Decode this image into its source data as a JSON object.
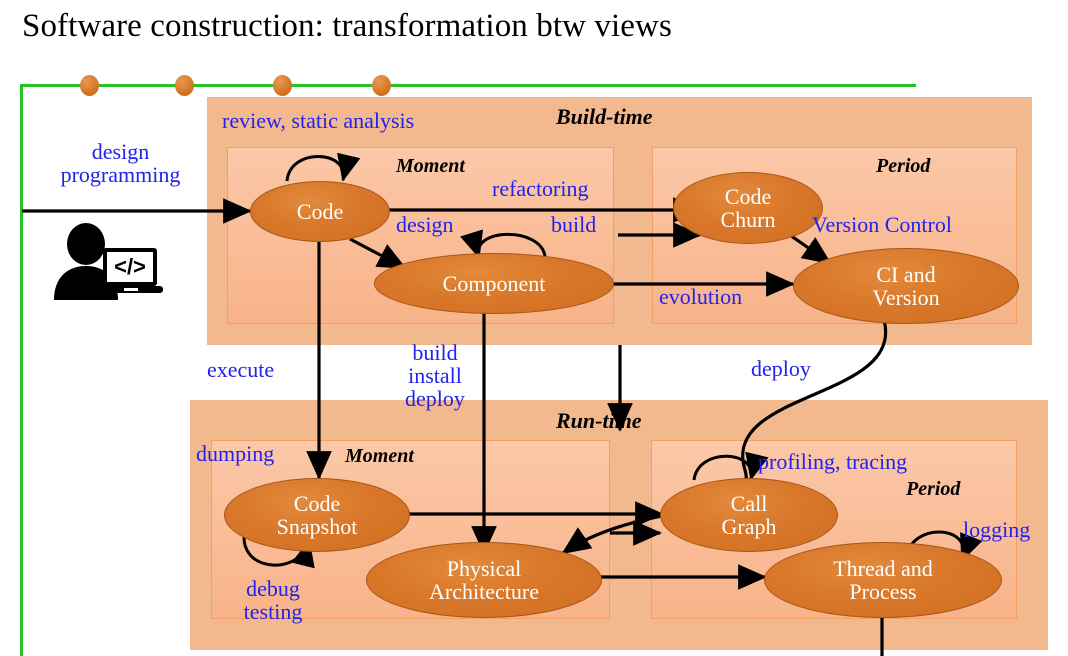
{
  "slide": {
    "title": "Software construction: transformation btw views"
  },
  "timeline": {
    "name": "scope-line",
    "dot_count": 4,
    "color": "#22c522",
    "dot_color": "#d2701e"
  },
  "actor": {
    "icon": "developer-with-laptop-icon",
    "code_glyph": "</>"
  },
  "phases": [
    {
      "id": "build-time",
      "label": "Build-time",
      "subboxes": [
        {
          "id": "build-moment",
          "label": "Moment"
        },
        {
          "id": "build-period",
          "label": "Period"
        }
      ]
    },
    {
      "id": "run-time",
      "label": "Run-time",
      "subboxes": [
        {
          "id": "run-moment",
          "label": "Moment"
        },
        {
          "id": "run-period",
          "label": "Period"
        }
      ]
    }
  ],
  "nodes": [
    {
      "id": "code",
      "lines": [
        "Code"
      ]
    },
    {
      "id": "component",
      "lines": [
        "Component"
      ]
    },
    {
      "id": "code-churn",
      "lines": [
        "Code",
        "Churn"
      ]
    },
    {
      "id": "ci-version",
      "lines": [
        "CI and",
        "Version"
      ]
    },
    {
      "id": "code-snapshot",
      "lines": [
        "Code",
        "Snapshot"
      ]
    },
    {
      "id": "physical-architecture",
      "lines": [
        "Physical",
        "Architecture"
      ]
    },
    {
      "id": "call-graph",
      "lines": [
        "Call",
        "Graph"
      ]
    },
    {
      "id": "thread-process",
      "lines": [
        "Thread and",
        "Process"
      ]
    }
  ],
  "edge_labels": [
    {
      "id": "design-programming",
      "lines": [
        "design",
        "programming"
      ]
    },
    {
      "id": "review-static-analysis",
      "lines": [
        "review, static analysis"
      ]
    },
    {
      "id": "refactoring",
      "lines": [
        "refactoring"
      ]
    },
    {
      "id": "design",
      "lines": [
        "design"
      ]
    },
    {
      "id": "build",
      "lines": [
        "build"
      ]
    },
    {
      "id": "version-control",
      "lines": [
        "Version Control"
      ]
    },
    {
      "id": "evolution",
      "lines": [
        "evolution"
      ]
    },
    {
      "id": "execute",
      "lines": [
        "execute"
      ]
    },
    {
      "id": "build-install-deploy",
      "lines": [
        "build",
        "install",
        "deploy"
      ]
    },
    {
      "id": "deploy",
      "lines": [
        "deploy"
      ]
    },
    {
      "id": "dumping",
      "lines": [
        "dumping"
      ]
    },
    {
      "id": "debug-testing",
      "lines": [
        "debug",
        "testing"
      ]
    },
    {
      "id": "profiling-tracing",
      "lines": [
        "profiling, tracing"
      ]
    },
    {
      "id": "logging",
      "lines": [
        "logging"
      ]
    }
  ],
  "colors": {
    "label_blue": "#2222ee",
    "node_orange": "#d9772a",
    "phase_bg": "#f2b98f",
    "subbox_bg": "#f9bb93",
    "scope_green": "#22c522"
  }
}
